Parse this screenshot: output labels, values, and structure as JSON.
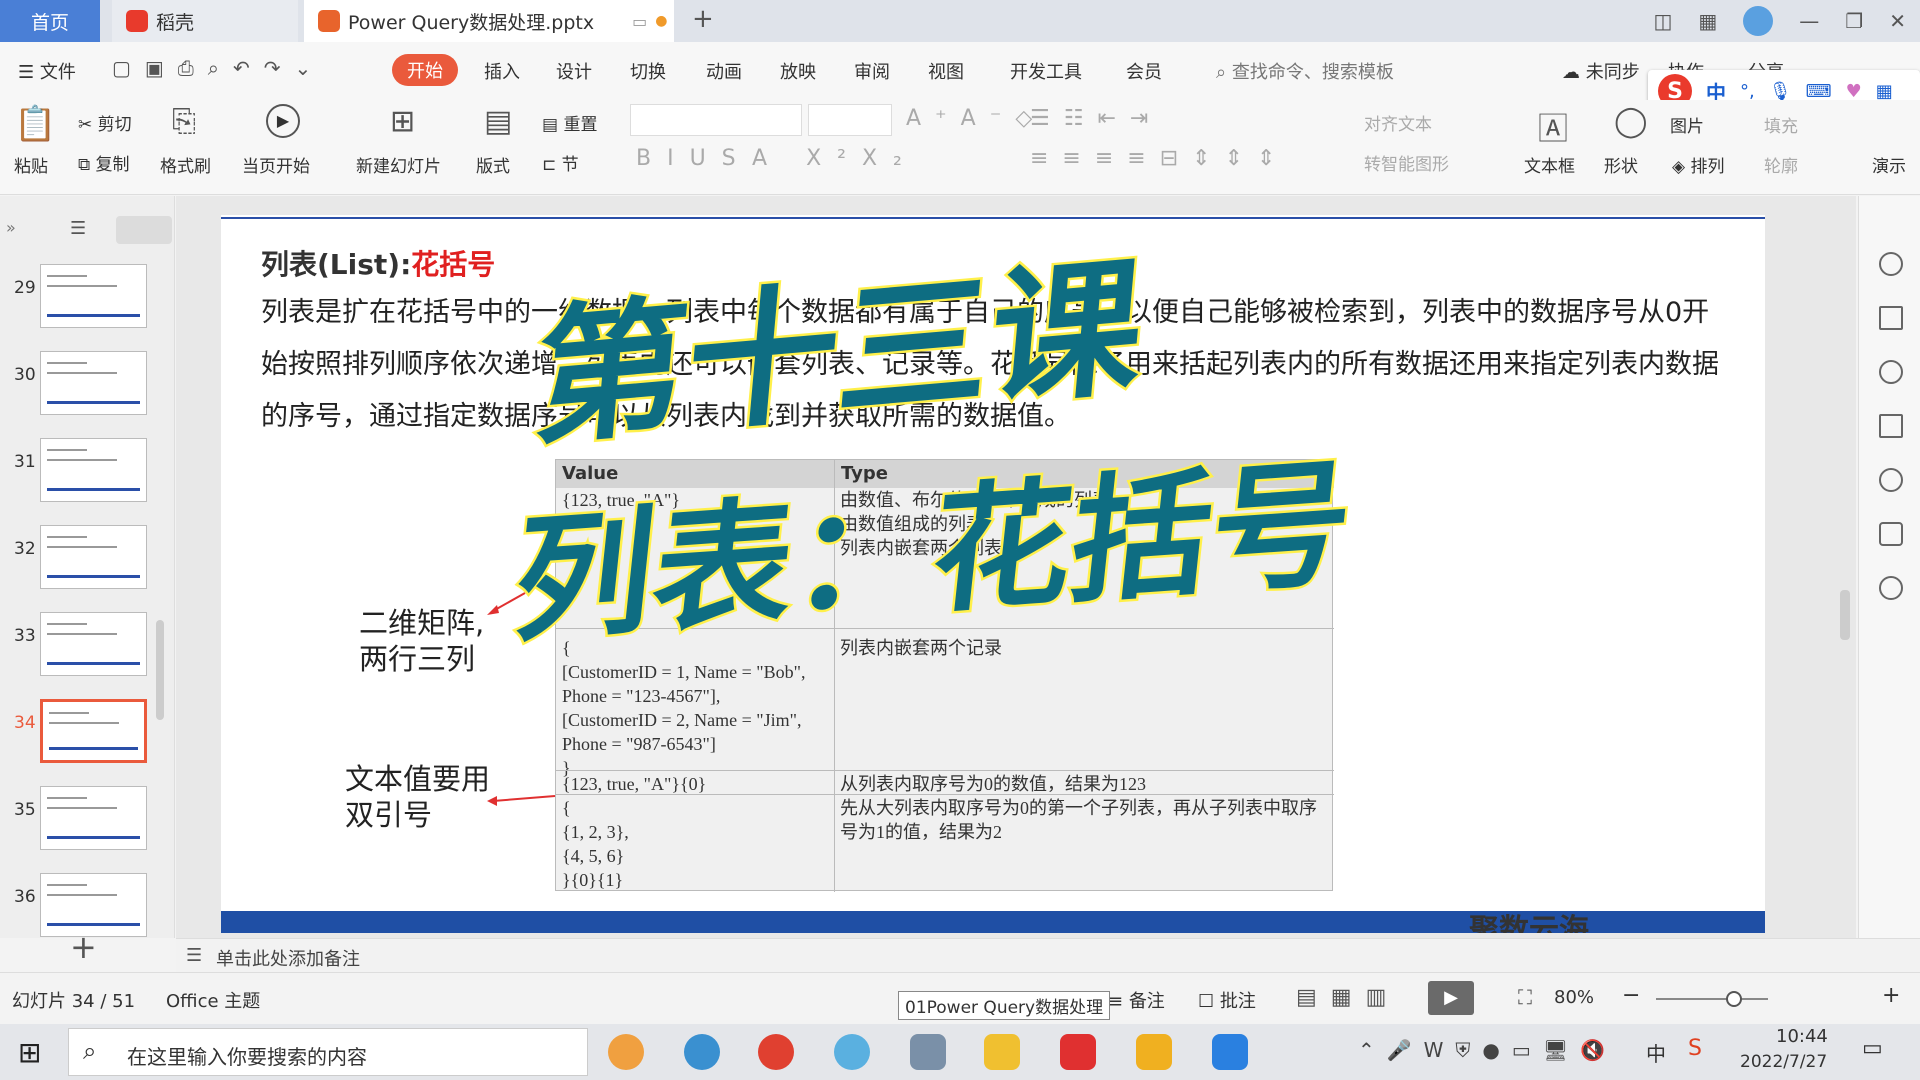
{
  "titlebar": {
    "tab_home": "首页",
    "tab_daoke": "稻壳",
    "tab_doc": "Power Query数据处理.pptx"
  },
  "menu": {
    "file": "文件",
    "items": [
      "开始",
      "插入",
      "设计",
      "切换",
      "动画",
      "放映",
      "审阅",
      "视图",
      "开发工具",
      "会员"
    ],
    "search_placeholder": "查找命令、搜索模板",
    "sync": "未同步",
    "collab": "协作",
    "share": "分享"
  },
  "ribbon": {
    "paste": "粘贴",
    "cut": "剪切",
    "copy": "复制",
    "format_painter": "格式刷",
    "from_current": "当页开始",
    "new_slide": "新建幻灯片",
    "layout": "版式",
    "reset": "重置",
    "section": "节",
    "align_text": "对齐文本",
    "smartart": "转智能图形",
    "textbox": "文本框",
    "shape": "形状",
    "picture": "图片",
    "fill": "填充",
    "arrange": "排列",
    "outline": "轮廓",
    "present": "演示"
  },
  "ime": {
    "lang": "中"
  },
  "slides_panel": {
    "numbers": [
      "29",
      "30",
      "31",
      "32",
      "33",
      "34",
      "35",
      "36"
    ],
    "current": "34"
  },
  "slide": {
    "heading_black": "列表(List):",
    "heading_red": "花括号",
    "body": "列表是扩在花括号中的一组数据，列表中每个数据都有属于自己的序号，以便自己能够被检索到，列表中的数据序号从0开始按照排列顺序依次递增，列表内还可以嵌套列表、记录等。花括号除了用来括起列表内的所有数据还用来指定列表内数据的序号，通过指定数据序号可以从列表内找到并获取所需的数据值。",
    "table": {
      "headers": [
        "Value",
        "Type"
      ],
      "rows": [
        {
          "value": "{123, true, \"A\"}",
          "type": "由数值、布尔值和文本组成的列表"
        },
        {
          "value": "",
          "type": "由数值组成的列表"
        },
        {
          "value": "",
          "type": "列表内嵌套两个列表"
        },
        {
          "value": "{\n[CustomerID = 1, Name = \"Bob\",\nPhone = \"123-4567\"],\n[CustomerID = 2, Name = \"Jim\",\nPhone = \"987-6543\"]\n}",
          "type": "列表内嵌套两个记录"
        },
        {
          "value": "{123, true, \"A\"}{0}",
          "type": "从列表内取序号为0的数值，结果为123"
        },
        {
          "value": "{\n{1, 2, 3},\n{4, 5, 6}\n}{0}{1}",
          "type": "先从大列表内取序号为0的第一个子列表，再从子列表中取序号为1的值，结果为2"
        }
      ]
    },
    "annotation_1": "二维矩阵,\n两行三列",
    "annotation_2": "文本值要用\n双引号",
    "footer_partial": "聚数云海"
  },
  "overlay": {
    "line1": "第十三课",
    "line2": "列表：花括号"
  },
  "notes": {
    "placeholder": "单击此处添加备注"
  },
  "status": {
    "slide_pos": "幻灯片 34 / 51",
    "theme": "Office 主题",
    "tooltip": "01Power Query数据处理",
    "notes_btn": "备注",
    "comment_btn": "批注",
    "zoom": "80%"
  },
  "taskbar": {
    "search_placeholder": "在这里输入你要搜索的内容",
    "time": "10:44",
    "date": "2022/7/27",
    "ime": "中"
  },
  "colors": {
    "accent": "#ea5a3c",
    "slide_blue": "#1f4fa5",
    "overlay_fill": "#0e6d82",
    "overlay_stroke": "#fff04a",
    "heading_red": "#e02020"
  }
}
